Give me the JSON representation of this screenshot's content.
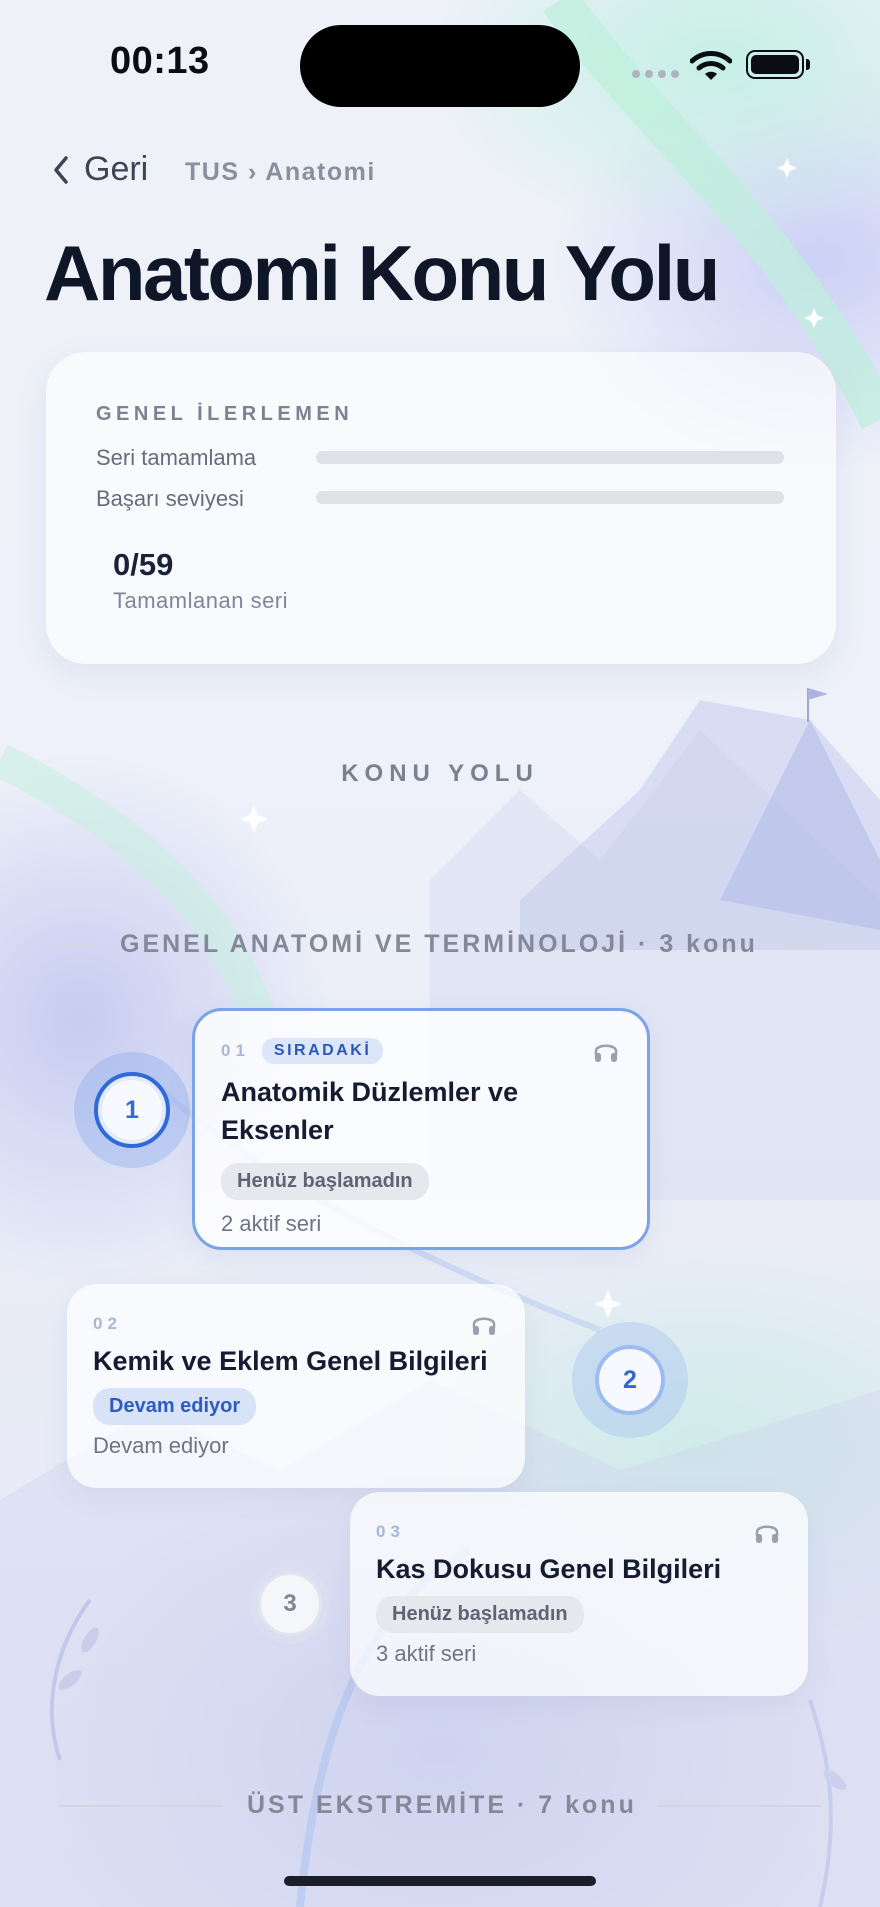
{
  "status_bar": {
    "time": "00:13"
  },
  "nav": {
    "back_label": "Geri",
    "breadcrumb": "TUS › Anatomi"
  },
  "page_title": "Anatomi Konu Yolu",
  "progress": {
    "heading": "GENEL İLERLEMEN",
    "rows": [
      {
        "label": "Seri tamamlama",
        "fraction": 0
      },
      {
        "label": "Başarı seviyesi",
        "fraction": 0
      }
    ],
    "count": "0/59",
    "count_label": "Tamamlanan seri"
  },
  "path_title": "KONU YOLU",
  "sections": [
    {
      "title": "GENEL ANATOMİ VE TERMİNOLOJİ · 3 konu",
      "topics": [
        {
          "node": "1",
          "number": "01",
          "badge": "SIRADAKİ",
          "title": "Anatomik Düzlemler ve Eksenler",
          "status": "Henüz başlamadın",
          "sub": "2 aktif seri"
        },
        {
          "node": "2",
          "number": "02",
          "badge": "",
          "title": "Kemik ve Eklem Genel Bilgileri",
          "status": "Devam ediyor",
          "sub": "Devam ediyor"
        },
        {
          "node": "3",
          "number": "03",
          "badge": "",
          "title": "Kas Dokusu Genel Bilgileri",
          "status": "Henüz başlamadın",
          "sub": "3 aktif seri"
        }
      ]
    },
    {
      "title": "ÜST EKSTREMİTE · 7 konu"
    }
  ],
  "icons": {
    "back": "chevron-left-icon",
    "topic": "headphones-icon",
    "wifi": "wifi-icon",
    "battery": "battery-icon"
  },
  "colors": {
    "accent": "#2f6ad8",
    "active_border": "#7aa3e8",
    "title": "#0f1628"
  }
}
